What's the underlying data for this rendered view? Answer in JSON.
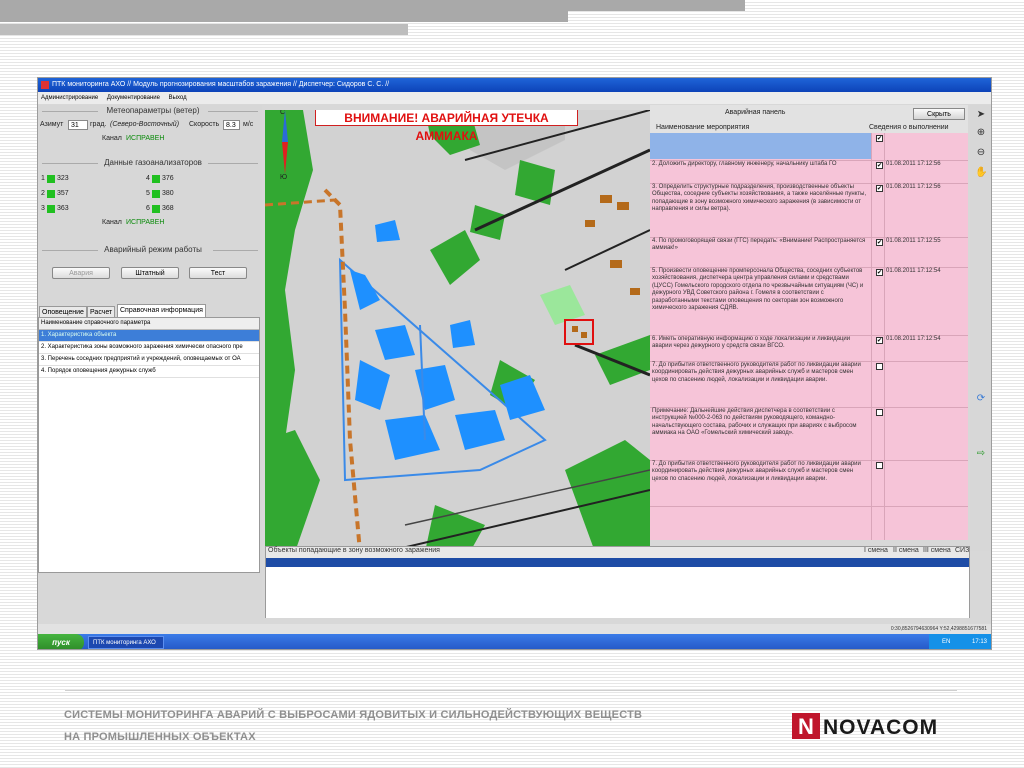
{
  "app": {
    "title": "ПТК мониторинга АХО // Модуль прогнозирования масштабов заражения // Диспетчер: Сидоров С. С. //",
    "menu": [
      "Администрирование",
      "Документирование",
      "Выход"
    ]
  },
  "meteo": {
    "title": "Метеопараметры (ветер)",
    "azimuth_label": "Азимут",
    "azimuth_value": "31",
    "grad_label": "град.",
    "direction": "(Северо-Восточный)",
    "speed_label": "Скорость",
    "speed_value": "8.3",
    "speed_unit": "м/с",
    "channel_label": "Канал",
    "channel_status": "ИСПРАВЕН"
  },
  "gas": {
    "title": "Данные газоанализаторов",
    "sensors": [
      {
        "id": "1",
        "value": "323"
      },
      {
        "id": "2",
        "value": "357"
      },
      {
        "id": "3",
        "value": "363"
      },
      {
        "id": "4",
        "value": "376"
      },
      {
        "id": "5",
        "value": "380"
      },
      {
        "id": "6",
        "value": "368"
      }
    ],
    "channel_label": "Канал",
    "channel_status": "ИСПРАВЕН",
    "indicator_color": "#20c020"
  },
  "emergency": {
    "title": "Аварийный режим работы",
    "buttons": [
      "Авария",
      "Штатный",
      "Тест"
    ]
  },
  "tabs": [
    "Оповещение",
    "Расчет",
    "Справочная информация"
  ],
  "reference": {
    "header": "Наименование справочного параметра",
    "rows": [
      "1. Характеристика объекта",
      "2. Характеристика зоны возможного заражения химически опасного пре",
      "3. Перечень соседних предприятий и учреждений, оповещаемых от ОА",
      "4. Порядок оповещения дежурных служб"
    ]
  },
  "map": {
    "alarm_text": "ВНИМАНИЕ! АВАРИЙНАЯ УТЕЧКА АММИАКА",
    "compass_north": "С",
    "compass_south": "Ю",
    "accent_red": "#e01010"
  },
  "panel": {
    "title": "Аварийная панель",
    "hide_button": "Скрыть",
    "col_action": "Наименование мероприятия",
    "col_status": "Сведения о выполнении",
    "actions": [
      {
        "text": "2. Доложить директору, главному инженеру, начальнику штаба ГО",
        "checked": "✔",
        "date": "01.08.2011 17:12:56"
      },
      {
        "text": "3. Определить структурные подразделения, производственные объекты Общества, соседние субъекты хозяйствования, а также населённые пункты, попадающие в зону возможного химического заражения (в зависимости от направления и силы ветра).",
        "checked": "✔",
        "date": "01.08.2011 17:12:56"
      },
      {
        "text": "4. По промоговорящей связи (ГГС) передать: «Внимание! Распространяется аммиак!»",
        "checked": "✔",
        "date": "01.08.2011 17:12:55"
      },
      {
        "text": "5. Произвести оповещение промперсонала Общества, соседних субъектов хозяйствования, диспетчера центра управления силами и средствами (ЦУСС) Гомельского городского отдела по чрезвычайным ситуациям (ЧС) и дежурного УВД Советского района г. Гомеля в соответствии с разработанными текстами оповещения по секторам зон возможного химического заражения СДЯВ.",
        "checked": "✔",
        "date": "01.08.2011 17:12:54"
      },
      {
        "text": "6. Иметь оперативную информацию о ходе локализации и ликвидации аварии через дежурного у средств связи ВГСО.",
        "checked": "✔",
        "date": "01.08.2011 17:12:54"
      },
      {
        "text": "7. До прибытия ответственного руководителя работ по ликвидации аварии координировать действия дежурных аварийных служб и мастеров смен цехов по спасению людей, локализации и ликвидации аварии.",
        "checked": "",
        "date": ""
      },
      {
        "text": "Примечание: Дальнейшие действия диспетчера в соответствии с инструкцией №000-2-063 по действиям руководящего, командно-начальствующего состава, рабочих и служащих при авариях с выбросом аммиака на ОАО «Гомельский химический завод».",
        "checked": "",
        "date": ""
      },
      {
        "text": "7. До прибытия ответственного руководителя работ по ликвидации аварии координировать действия дежурных аварийных служб и мастеров смен цехов по спасению людей, локализации и ликвидации аварии.",
        "checked": "",
        "date": ""
      }
    ],
    "bg_color": "#f6c4d8"
  },
  "objects": {
    "header": "Объекты попадающие в зону возможного заражения",
    "col1": "I смена",
    "col2": "II смена",
    "col3": "III смена",
    "col4": "СИЗ"
  },
  "statusbar": "0:30,8526794630964 Y:52,4298851677581",
  "taskbar": {
    "start": "пуск",
    "task": "ПТК мониторинга АХО",
    "lang": "EN",
    "time": "17:13"
  },
  "footer": {
    "line1": "СИСТЕМЫ МОНИТОРИНГА АВАРИЙ С ВЫБРОСАМИ ЯДОВИТЫХ И СИЛЬНОДЕЙСТВУЮЩИХ ВЕЩЕСТВ",
    "line2": "НА ПРОМЫШЛЕННЫХ ОБЪЕКТАХ",
    "logo_letter": "N",
    "logo_text": "NOVACOM",
    "logo_color": "#c0162c"
  }
}
